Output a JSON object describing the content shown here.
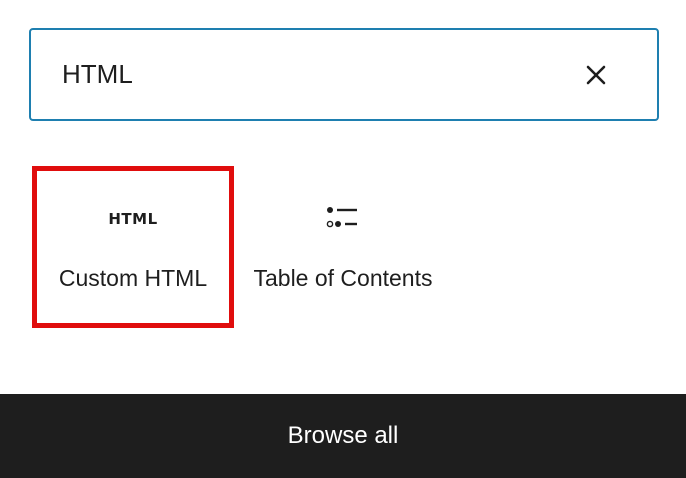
{
  "search": {
    "value": "HTML",
    "clear_icon": "close-icon"
  },
  "results": [
    {
      "icon": "html-icon",
      "icon_text": "HTML",
      "label": "Custom HTML",
      "selected": true
    },
    {
      "icon": "table-of-contents-icon",
      "label": "Table of Contents",
      "selected": false
    }
  ],
  "footer": {
    "browse_all_label": "Browse all"
  },
  "colors": {
    "search_border": "#1e7fb0",
    "selection_outline": "#e00d0d",
    "footer_background": "#1e1e1e",
    "text": "#1e1e1e"
  }
}
